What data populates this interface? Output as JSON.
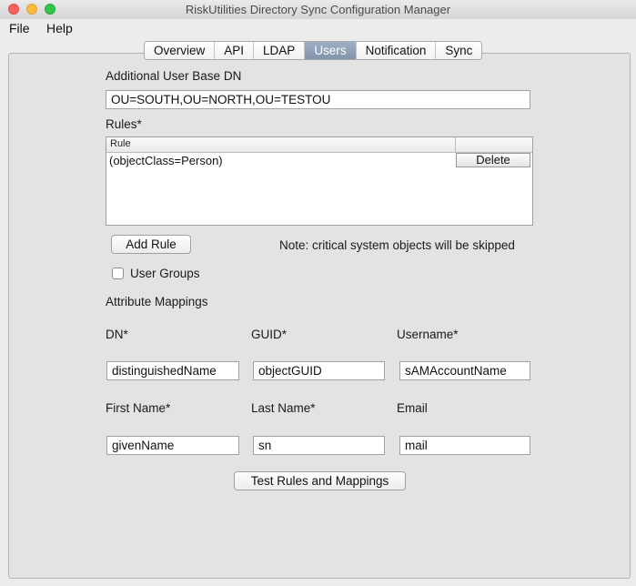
{
  "window": {
    "title": "RiskUtilities Directory Sync Configuration Manager"
  },
  "menu": {
    "file": "File",
    "help": "Help"
  },
  "tabs": [
    {
      "label": "Overview",
      "active": false
    },
    {
      "label": "API",
      "active": false
    },
    {
      "label": "LDAP",
      "active": false
    },
    {
      "label": "Users",
      "active": true
    },
    {
      "label": "Notification",
      "active": false
    },
    {
      "label": "Sync",
      "active": false
    }
  ],
  "users": {
    "base_dn_label": "Additional User Base DN",
    "base_dn_value": "OU=SOUTH,OU=NORTH,OU=TESTOU",
    "rules_label": "Rules*",
    "rules_table": {
      "columns": [
        "Rule",
        ""
      ],
      "rows": [
        {
          "rule": "(objectClass=Person)",
          "action": "Delete"
        }
      ]
    },
    "add_rule_button": "Add Rule",
    "note": "Note: critical system objects will be skipped",
    "user_groups_checkbox": {
      "label": "User  Groups",
      "checked": false
    },
    "mappings_label": "Attribute Mappings",
    "mappings": {
      "dn": {
        "label": "DN*",
        "value": "distinguishedName"
      },
      "guid": {
        "label": "GUID*",
        "value": "objectGUID"
      },
      "username": {
        "label": "Username*",
        "value": "sAMAccountName"
      },
      "first_name": {
        "label": "First Name*",
        "value": "givenName"
      },
      "last_name": {
        "label": "Last Name*",
        "value": "sn"
      },
      "email": {
        "label": "Email",
        "value": "mail"
      }
    },
    "test_button": "Test Rules and Mappings"
  },
  "colors": {
    "active_tab": "#8fa0b5",
    "panel": "#e3e3e3",
    "window_bg": "#ececec"
  }
}
